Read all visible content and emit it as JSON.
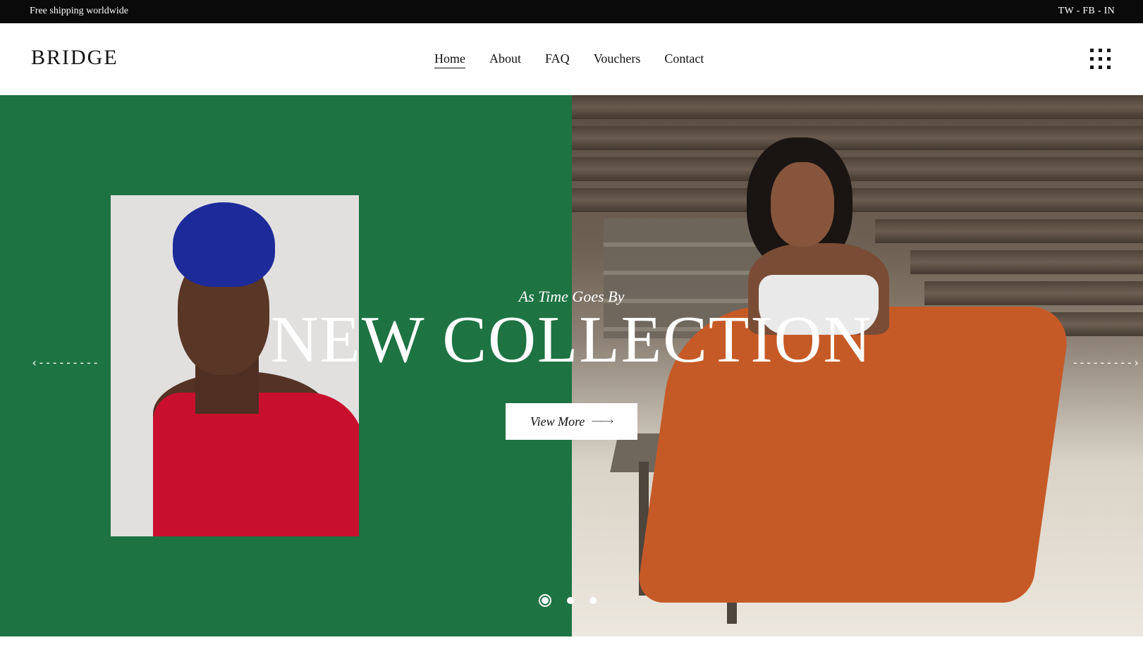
{
  "topbar": {
    "shipping_text": "Free shipping worldwide",
    "social_text": "TW - FB - IN"
  },
  "header": {
    "logo": "BRIDGE",
    "nav": [
      {
        "label": "Home",
        "active": true
      },
      {
        "label": "About",
        "active": false
      },
      {
        "label": "FAQ",
        "active": false
      },
      {
        "label": "Vouchers",
        "active": false
      },
      {
        "label": "Contact",
        "active": false
      }
    ],
    "menu_icon": "grid-menu-icon"
  },
  "hero": {
    "subtitle": "As Time Goes By",
    "title": "NEW COLLECTION",
    "button_label": "View More",
    "button_icon": "long-arrow-right-icon",
    "prev_icon": "arrow-left-icon",
    "next_icon": "arrow-right-icon",
    "slides_total": 3,
    "active_slide": 1,
    "colors": {
      "left_panel": "#1e7343",
      "accent_text": "#ffffff"
    }
  }
}
